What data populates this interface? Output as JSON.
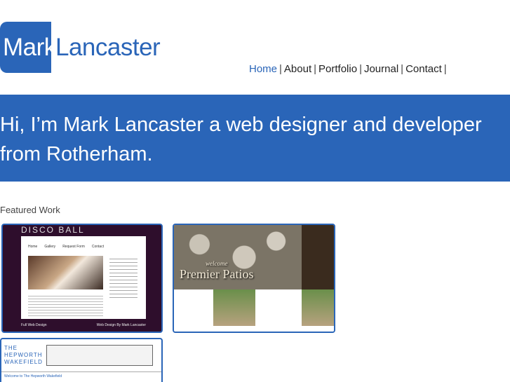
{
  "logo": {
    "first": "Mark",
    "last": "Lancaster"
  },
  "nav": {
    "items": [
      {
        "label": "Home",
        "active": true
      },
      {
        "label": "About"
      },
      {
        "label": "Portfolio"
      },
      {
        "label": "Journal"
      },
      {
        "label": "Contact"
      }
    ],
    "separator": "|"
  },
  "hero": {
    "text": "Hi, I’m Mark Lancaster a web designer and developer from Rotherham."
  },
  "featured": {
    "heading": "Featured Work"
  },
  "thumbs": {
    "disco": {
      "title": "DISCO BALL",
      "nav": [
        "Home",
        "Gallery",
        "Request Form",
        "Contact"
      ],
      "footer_left": "Full Web Design",
      "footer_right": "Web Design By Mark Lancaster"
    },
    "patios": {
      "welcome": "welcome",
      "name": "Premier Patios"
    },
    "hepworth": {
      "logo": "THE\nHEPWORTH\nWAKEFIELD",
      "bar_text": "Welcome to The Hepworth Wakefield"
    }
  },
  "colors": {
    "accent": "#2a65b8",
    "background": "#ffffff",
    "text": "#222222"
  }
}
